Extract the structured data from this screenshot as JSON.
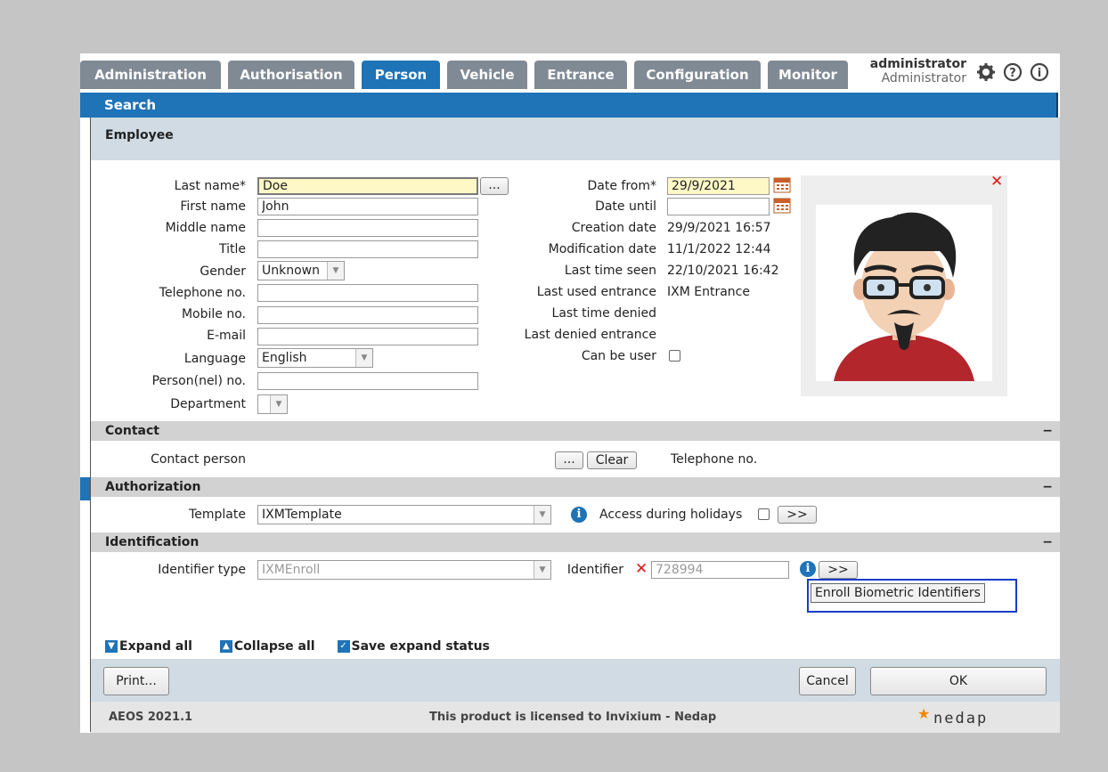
{
  "tabs": [
    {
      "label": "Administration",
      "active": false
    },
    {
      "label": "Authorisation",
      "active": false
    },
    {
      "label": "Person",
      "active": true
    },
    {
      "label": "Vehicle",
      "active": false
    },
    {
      "label": "Entrance",
      "active": false
    },
    {
      "label": "Configuration",
      "active": false
    },
    {
      "label": "Monitor",
      "active": false
    }
  ],
  "user": {
    "name": "administrator",
    "role": "Administrator"
  },
  "search_bar": "Search",
  "employee_header": "Employee",
  "person": {
    "last_name_label": "Last name*",
    "last_name": "Doe",
    "last_name_btn": "...",
    "first_name_label": "First name",
    "first_name": "John",
    "middle_name_label": "Middle name",
    "middle_name": "",
    "title_label": "Title",
    "title": "",
    "gender_label": "Gender",
    "gender": "Unknown",
    "telephone_label": "Telephone no.",
    "telephone": "",
    "mobile_label": "Mobile no.",
    "mobile": "",
    "email_label": "E-mail",
    "email": "",
    "language_label": "Language",
    "language": "English",
    "personnel_label": "Person(nel) no.",
    "personnel": "",
    "department_label": "Department",
    "department": ""
  },
  "dates": {
    "date_from_label": "Date from*",
    "date_from": "29/9/2021",
    "date_until_label": "Date until",
    "date_until": "",
    "creation_label": "Creation date",
    "creation": "29/9/2021 16:57",
    "modification_label": "Modification date",
    "modification": "11/1/2022 12:44",
    "last_seen_label": "Last time seen",
    "last_seen": "22/10/2021 16:42",
    "last_entrance_label": "Last used entrance",
    "last_entrance": "IXM Entrance",
    "last_denied_label": "Last time denied",
    "last_denied": "",
    "last_denied_entrance_label": "Last denied entrance",
    "last_denied_entrance": "",
    "can_be_user_label": "Can be user"
  },
  "contact": {
    "header": "Contact",
    "collapse": "−",
    "person_label": "Contact person",
    "browse_btn": "...",
    "clear_btn": "Clear",
    "telephone_label": "Telephone no."
  },
  "authorization": {
    "header": "Authorization",
    "collapse": "−",
    "template_label": "Template",
    "template": "IXMTemplate",
    "holidays_label": "Access during holidays",
    "more_btn": ">>"
  },
  "identification": {
    "header": "Identification",
    "collapse": "−",
    "type_label": "Identifier type",
    "type": "IXMEnroll",
    "identifier_label": "Identifier",
    "identifier": "728994",
    "more_btn": ">>",
    "enroll_tooltip": "Enroll Biometric Identifiers"
  },
  "expand": {
    "expand_all": "Expand all",
    "collapse_all": "Collapse all",
    "save_status": "Save expand status"
  },
  "buttons": {
    "print": "Print...",
    "cancel": "Cancel",
    "ok": "OK"
  },
  "footer": {
    "version": "AEOS 2021.1",
    "license": "This product is licensed to Invixium - Nedap",
    "brand": "nedap"
  },
  "colors": {
    "accent": "#1f73b7",
    "tab_inactive": "#808a95",
    "error": "#e01818"
  }
}
